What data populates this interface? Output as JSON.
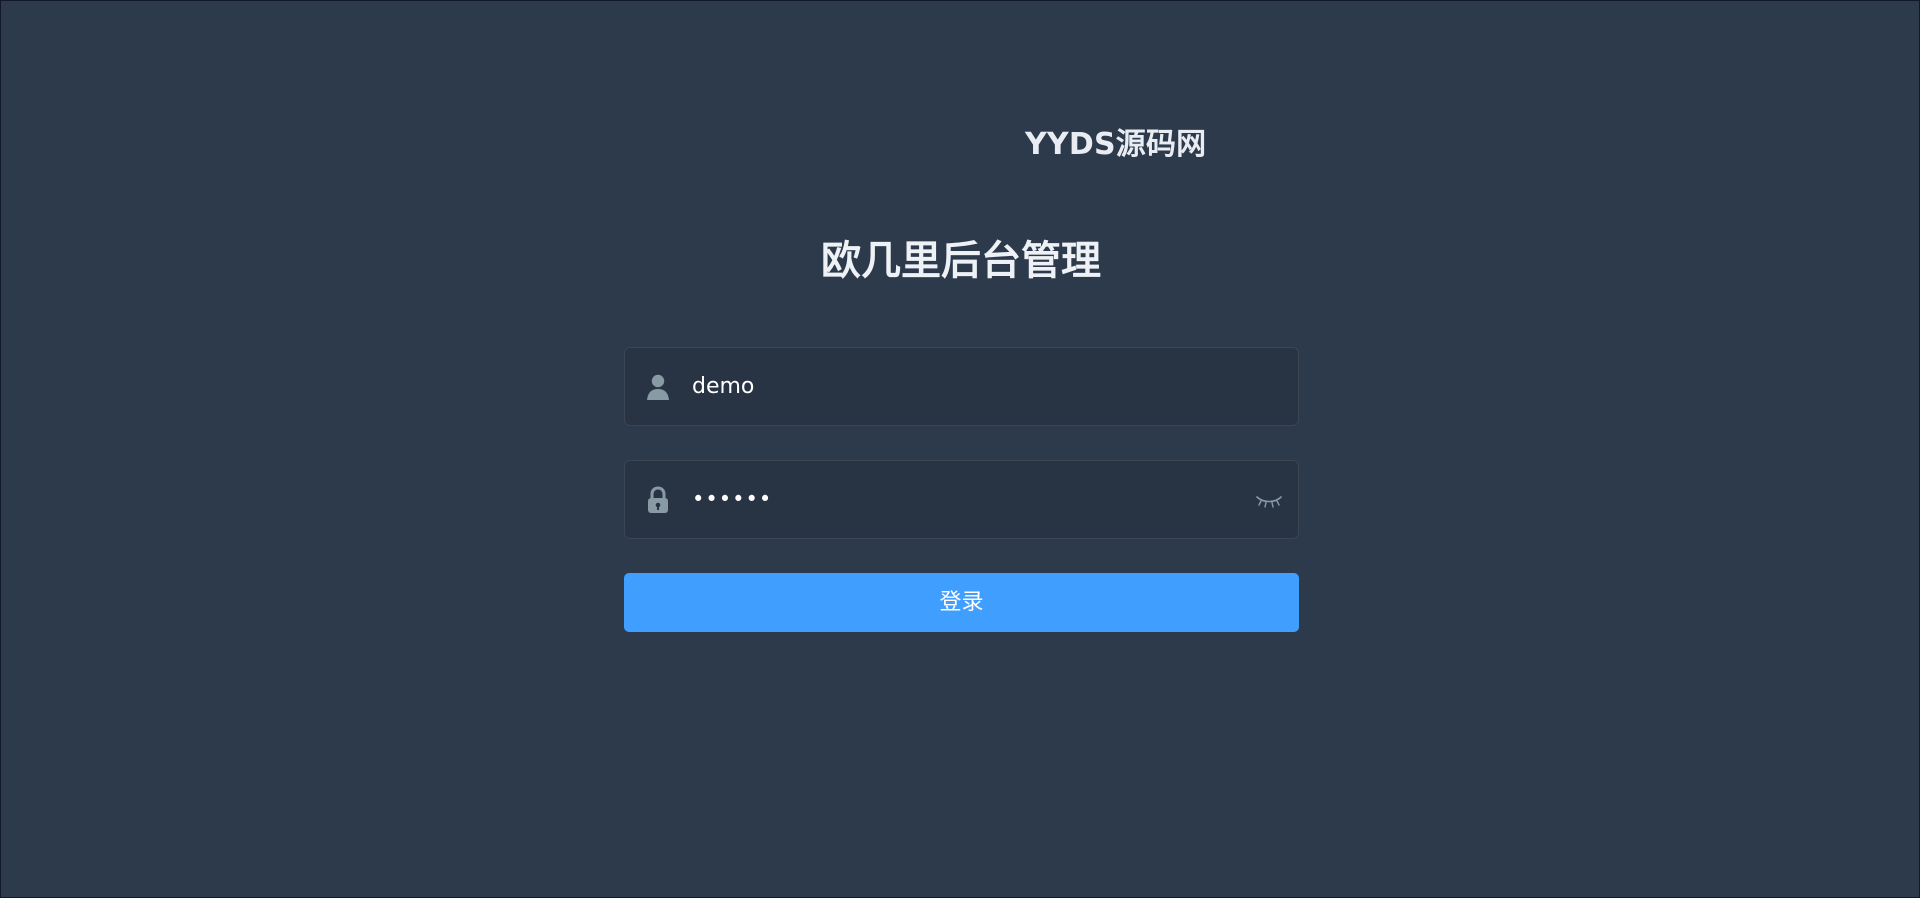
{
  "brand": {
    "watermark": "YYDS源码网"
  },
  "login": {
    "title": "欧几里后台管理",
    "username": {
      "value": "demo",
      "icon": "user-icon"
    },
    "password": {
      "value": "••••••",
      "icon": "lock-icon",
      "toggle_icon": "eye-closed-icon"
    },
    "submit_label": "登录"
  },
  "colors": {
    "background": "#2d3a4b",
    "field_background": "#283443",
    "field_border": "#3b4554",
    "primary": "#409eff",
    "icon": "#889aa4"
  }
}
